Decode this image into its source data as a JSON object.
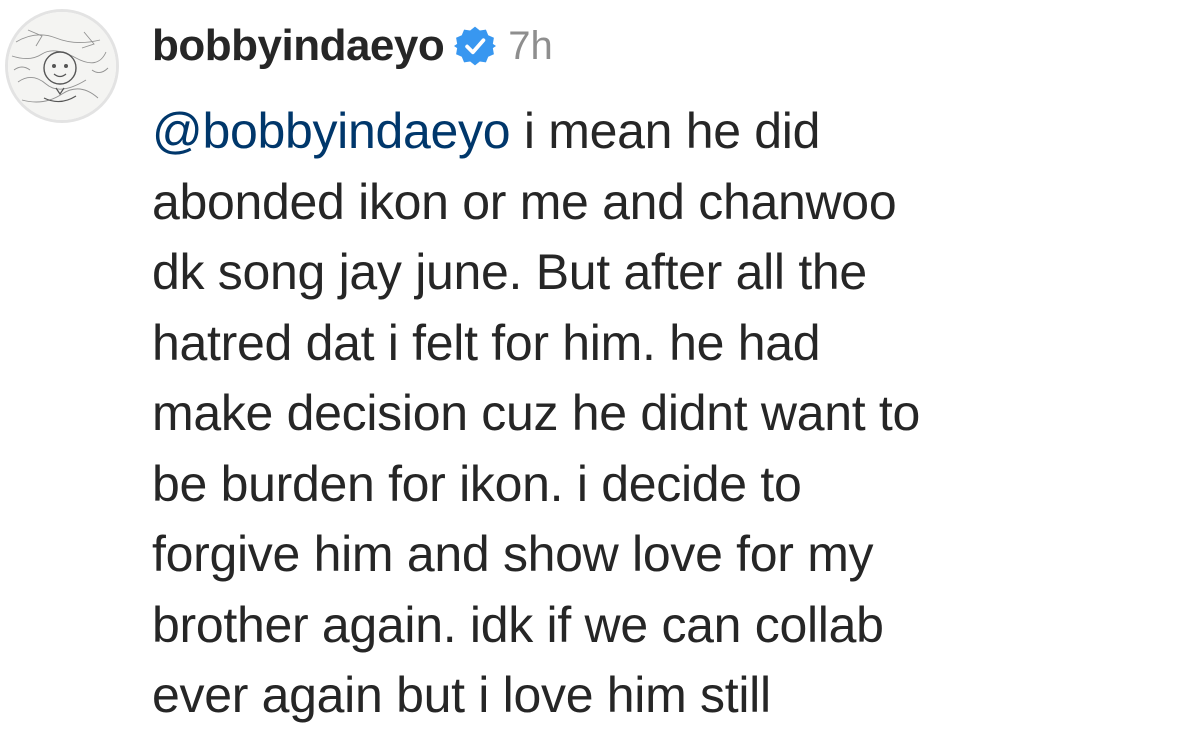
{
  "comment": {
    "username": "bobbyindaeyo",
    "time": "7h",
    "mention": "@bobbyindaeyo",
    "text": " i mean he did\nabonded ikon or me and chanwoo\ndk song jay  june. But after all the\nhatred dat i felt for him. he had\nmake decision cuz he didnt want to\nbe burden for ikon. i decide to\nforgive him and show love for my\nbrother again. idk if we can collab\never again but i love him still"
  },
  "icons": {
    "avatar": "profile-avatar",
    "verified": "verified-badge-icon"
  },
  "colors": {
    "text": "#262626",
    "mention": "#00376b",
    "muted": "#8e8e8e",
    "verified": "#3897f0"
  }
}
